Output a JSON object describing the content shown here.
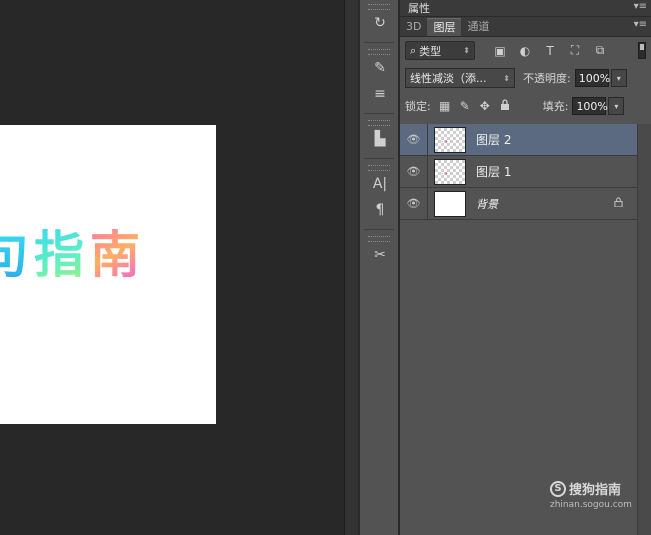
{
  "canvas": {
    "text_chars": [
      "句",
      "指",
      "南"
    ]
  },
  "tools": [
    {
      "icon": "history-icon",
      "glyph": "↻"
    },
    {
      "icon": "brush-preset-icon",
      "glyph": "✎"
    },
    {
      "icon": "adjustments-icon",
      "glyph": "≡"
    },
    {
      "icon": "clone-source-icon",
      "glyph": "▙"
    },
    {
      "icon": "character-icon",
      "glyph": "A|"
    },
    {
      "icon": "paragraph-icon",
      "glyph": "¶"
    },
    {
      "icon": "tool-presets-icon",
      "glyph": "✂"
    }
  ],
  "properties": {
    "title": "属性"
  },
  "tabs": [
    {
      "label": "3D",
      "active": false
    },
    {
      "label": "图层",
      "active": true
    },
    {
      "label": "通道",
      "active": false
    }
  ],
  "filter": {
    "kind_label": "类型",
    "icons": [
      "▣",
      "◐",
      "T",
      "⛶",
      "⧉"
    ]
  },
  "blend": {
    "mode": "线性减淡（添...",
    "opacity_label": "不透明度:",
    "opacity_value": "100%",
    "lock_label": "锁定:",
    "fill_label": "填充:",
    "fill_value": "100%",
    "lock_icons": [
      "▦",
      "✎",
      "✥",
      "🔒"
    ]
  },
  "layers": [
    {
      "name": "图层 2",
      "selected": true,
      "type": "transparent"
    },
    {
      "name": "图层 1",
      "selected": false,
      "type": "transparent"
    },
    {
      "name": "背景",
      "selected": false,
      "type": "background",
      "locked": true
    }
  ],
  "watermark": {
    "brand": "搜狗指南",
    "url": "zhinan.sogou.com"
  },
  "colors": {
    "panel_bg": "#535353",
    "selected_layer": "#5b6a80",
    "canvas_bg": "#282828"
  }
}
